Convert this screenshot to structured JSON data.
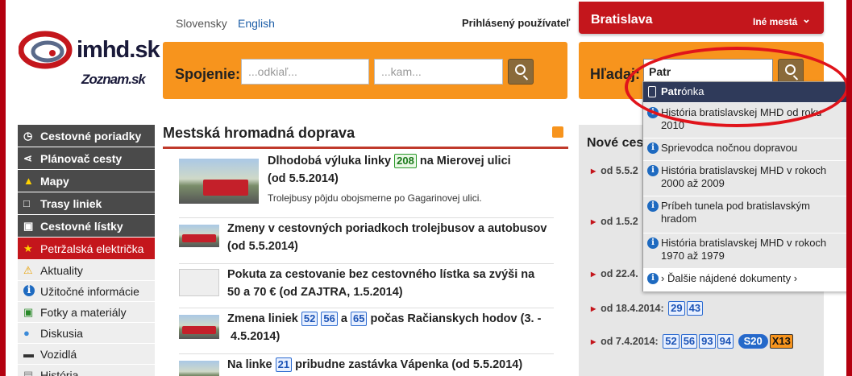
{
  "header": {
    "logo_text": "imhd.sk",
    "partner_logo": "Zoznam.sk",
    "languages": [
      "Slovensky",
      "English"
    ],
    "logged_user": "Prihlásený používateľ",
    "city": "Bratislava",
    "other_cities": "Iné mestá"
  },
  "connection": {
    "label": "Spojenie:",
    "from_placeholder": "...odkiaľ...",
    "to_placeholder": "...kam..."
  },
  "search": {
    "label": "Hľadaj:",
    "value": "Patr"
  },
  "sidebar": {
    "items": [
      {
        "label": "Cestovné poriadky",
        "icon": "clock-icon"
      },
      {
        "label": "Plánovač cesty",
        "icon": "route-icon"
      },
      {
        "label": "Mapy",
        "icon": "map-icon"
      },
      {
        "label": "Trasy liniek",
        "icon": "stop-sign-icon"
      },
      {
        "label": "Cestovné lístky",
        "icon": "ticket-icon"
      },
      {
        "label": "Petržalská električka",
        "icon": "star-icon"
      },
      {
        "label": "Aktuality",
        "icon": "warning-icon"
      },
      {
        "label": "Užitočné informácie",
        "icon": "info-icon"
      },
      {
        "label": "Fotky a materiály",
        "icon": "photo-icon"
      },
      {
        "label": "Diskusia",
        "icon": "speech-icon"
      },
      {
        "label": "Vozidlá",
        "icon": "car-icon"
      },
      {
        "label": "História",
        "icon": "history-icon"
      }
    ]
  },
  "main": {
    "title": "Mestská hromadná doprava",
    "news": [
      {
        "pre": "Dlhodobá výluka linky",
        "line": "208",
        "post": "na Mierovej ulici",
        "line2": "(od 5.5.2014)",
        "summary": "Trolejbusy pôjdu obojsmerne po Gagarinovej ulici."
      },
      {
        "text": "Zmeny v cestovných poriadkoch trolejbusov a autobusov",
        "line2": "(od 5.5.2014)"
      },
      {
        "text": "Pokuta za cestovanie bez cestovného lístka sa zvýši na",
        "line2": "50 a 70 € (od ZAJTRA, 1.5.2014)"
      },
      {
        "pre": "Zmena liniek",
        "lines": [
          "52",
          "56"
        ],
        "mid": "a",
        "line_b": "65",
        "post": "počas Račianskych hodov (3. -",
        "line2": "4.5.2014)"
      },
      {
        "pre": "Na linke",
        "line": "21",
        "post": "pribudne zastávka Vápenka (od 5.5.2014)"
      }
    ]
  },
  "right": {
    "title": "Nové cest",
    "items": [
      {
        "date": "od 5.5.2",
        "lines": []
      },
      {
        "date": "od 1.5.2",
        "lines": []
      },
      {
        "date": "od 22.4.",
        "lines": []
      },
      {
        "date": "od 18.4.2014:",
        "lines": [
          "29",
          "43"
        ]
      },
      {
        "date": "od 7.4.2014:",
        "lines": [
          "52",
          "56",
          "93",
          "94"
        ],
        "pill": "S20",
        "night": "X13"
      }
    ]
  },
  "dropdown": {
    "items": [
      {
        "bold": "Patr",
        "rest": "ónka",
        "type": "stop"
      },
      {
        "text": "História bratislavskej MHD od roku 2010"
      },
      {
        "text": "Sprievodca nočnou dopravou"
      },
      {
        "text": "História bratislavskej MHD v rokoch 2000 až 2009"
      },
      {
        "text": "Príbeh tunela pod bratislavským hradom"
      },
      {
        "text": "História bratislavskej MHD v rokoch 1970 až 1979"
      },
      {
        "text": "› Ďalšie nájdené dokumenty ›"
      }
    ]
  },
  "colors": {
    "brand_red": "#c4161c",
    "orange": "#f7941d",
    "highlight": "#e0141b"
  }
}
